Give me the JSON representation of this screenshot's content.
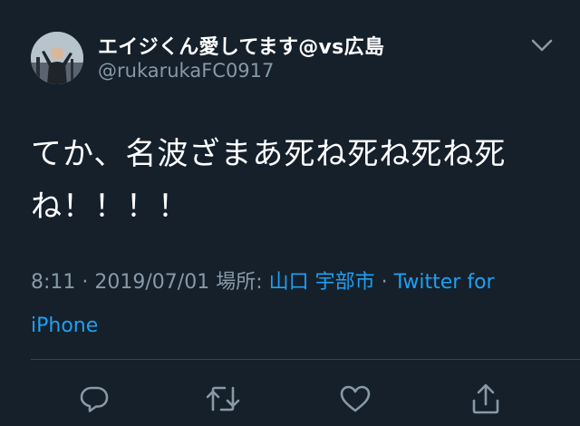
{
  "user": {
    "display_name": "エイジくん愛してます@vs広島",
    "handle": "@rukarukaFC0917",
    "avatar_icon": "user-avatar"
  },
  "tweet": {
    "text": "てか、名波ざまあ死ね死ね死ね死ね！！！！"
  },
  "meta": {
    "time": "8:11",
    "separator1": " · ",
    "date": "2019/07/01",
    "location_label": " 場所: ",
    "location": "山口 宇部市",
    "separator2": " · ",
    "source": "Twitter for iPhone"
  },
  "colors": {
    "background": "#15202b",
    "accent": "#1da1f2",
    "secondary_text": "#8899a6",
    "divider": "#38444d"
  },
  "icons": {
    "menu": "chevron-down-icon",
    "reply": "reply-icon",
    "retweet": "retweet-icon",
    "like": "heart-icon",
    "share": "share-icon"
  }
}
